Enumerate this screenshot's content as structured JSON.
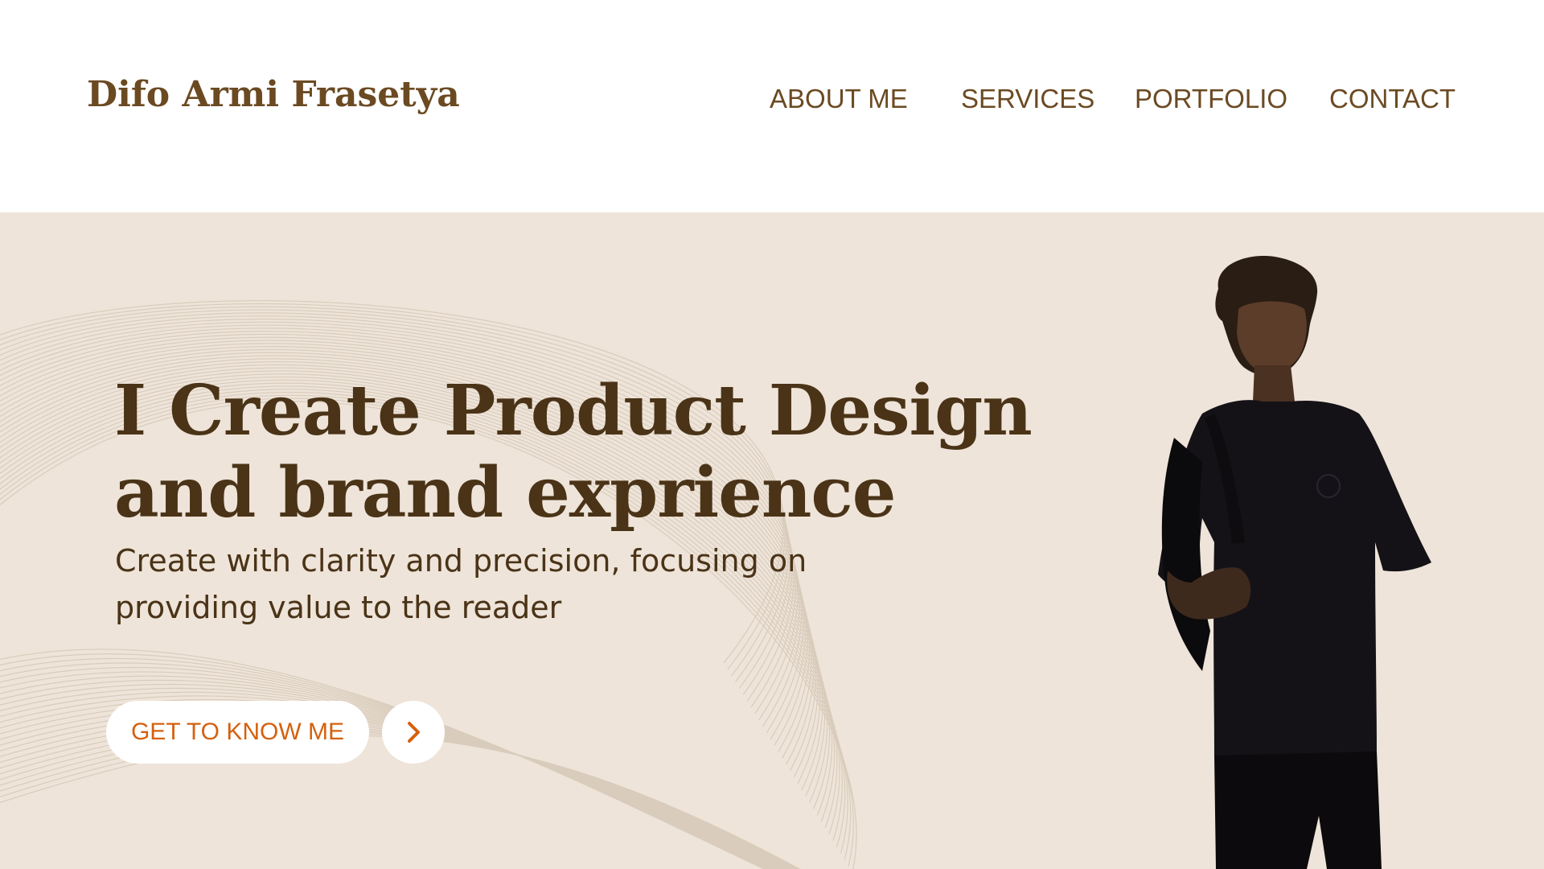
{
  "header": {
    "brand": "Difo Armi Frasetya",
    "nav": {
      "about": "ABOUT ME",
      "services": "SERVICES",
      "portfolio": "PORTFOLIO",
      "contact": "CONTACT"
    }
  },
  "hero": {
    "headline_line1": "I Create Product Design",
    "headline_line2": "and brand exprience",
    "subtext_line1": "Create with clarity and precision, focusing on",
    "subtext_line2": "providing value to the reader",
    "cta_label": "GET TO KNOW ME",
    "arrow_icon": "chevron-right-icon"
  },
  "colors": {
    "header_bg": "#ffffff",
    "hero_bg": "#eee4d9",
    "brand_text": "#6b4a22",
    "headline_text": "#4a3317",
    "cta_text": "#d4610e",
    "line_art": "#d9ccbc"
  }
}
